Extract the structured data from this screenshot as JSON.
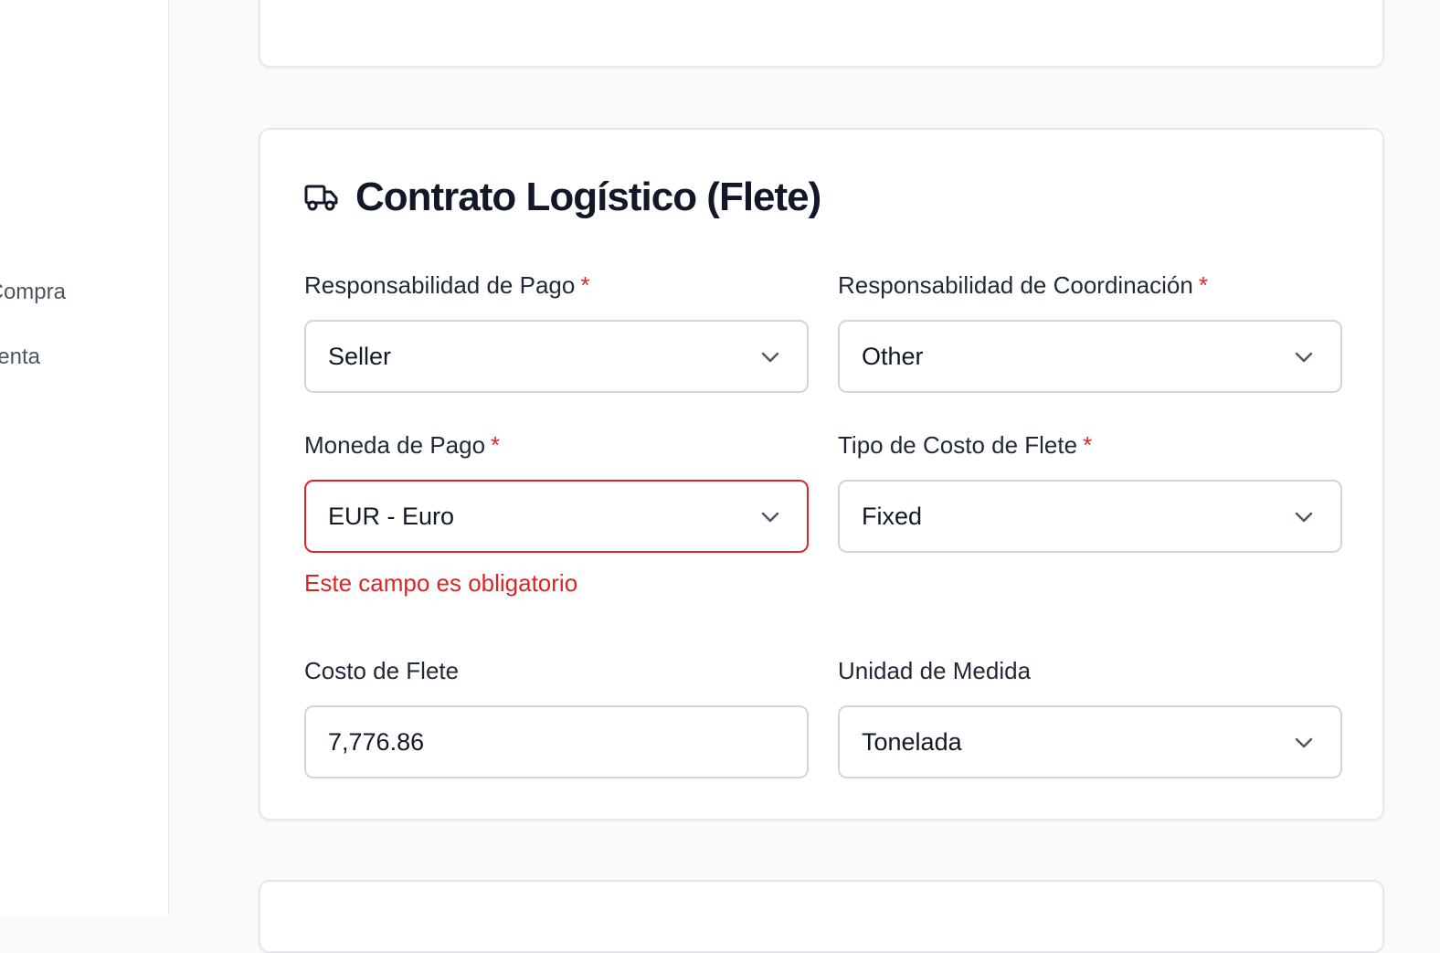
{
  "sidebar": {
    "items": [
      {
        "label": "Contratos de Compra"
      },
      {
        "label": "Contratos de Venta"
      }
    ]
  },
  "freight_section": {
    "title": "Contrato Logístico (Flete)",
    "icon": "truck-icon",
    "required_mark": "*",
    "fields": {
      "payment_responsibility": {
        "label": "Responsabilidad de Pago",
        "value": "Seller",
        "required": true
      },
      "coordination_responsibility": {
        "label": "Responsabilidad de Coordinación",
        "value": "Other",
        "required": true
      },
      "payment_currency": {
        "label": "Moneda de Pago",
        "value": "EUR - Euro",
        "required": true,
        "error": "Este campo es obligatorio"
      },
      "freight_cost_type": {
        "label": "Tipo de Costo de Flete",
        "value": "Fixed",
        "required": true
      },
      "freight_cost": {
        "label": "Costo de Flete",
        "value": "7,776.86"
      },
      "unit_of_measure": {
        "label": "Unidad de Medida",
        "value": "Tonelada"
      }
    }
  },
  "colors": {
    "error": "#dc2626",
    "border": "#d1d5db",
    "text": "#111827",
    "page_bg": "#f9fafb"
  }
}
